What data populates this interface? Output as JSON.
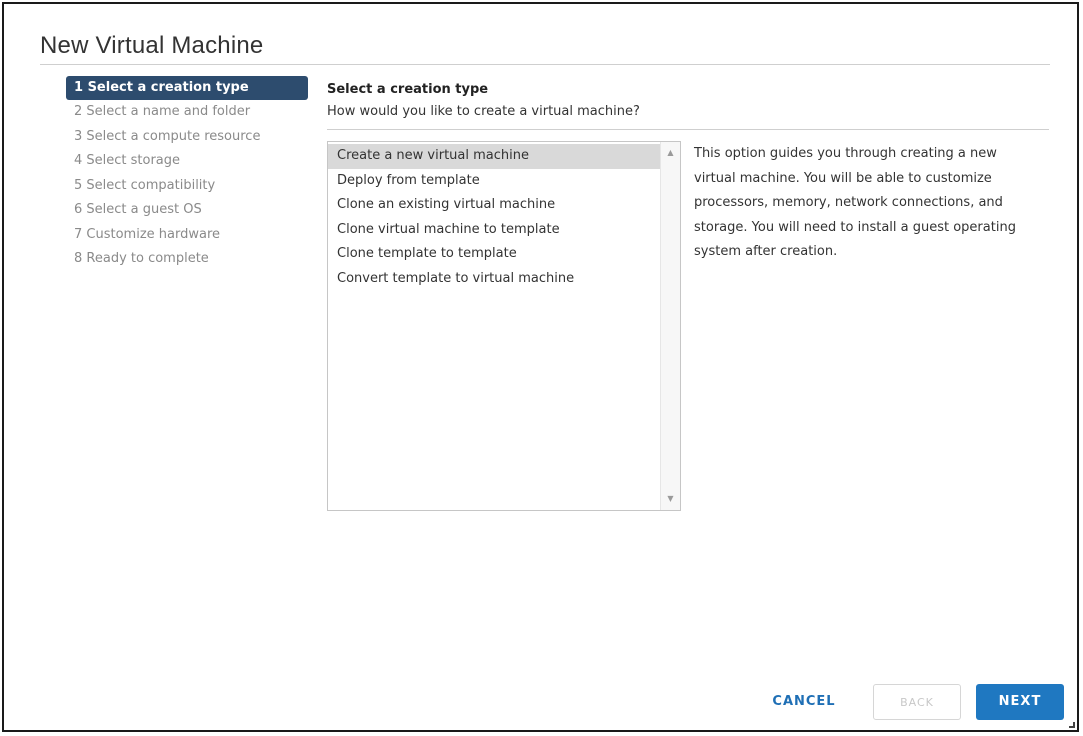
{
  "dialog": {
    "title": "New Virtual Machine"
  },
  "steps": [
    {
      "label": "1 Select a creation type",
      "active": true
    },
    {
      "label": "2 Select a name and folder",
      "active": false
    },
    {
      "label": "3 Select a compute resource",
      "active": false
    },
    {
      "label": "4 Select storage",
      "active": false
    },
    {
      "label": "5 Select compatibility",
      "active": false
    },
    {
      "label": "6 Select a guest OS",
      "active": false
    },
    {
      "label": "7 Customize hardware",
      "active": false
    },
    {
      "label": "8 Ready to complete",
      "active": false
    }
  ],
  "main": {
    "heading": "Select a creation type",
    "question": "How would you like to create a virtual machine?",
    "options": [
      {
        "label": "Create a new virtual machine",
        "selected": true
      },
      {
        "label": "Deploy from template",
        "selected": false
      },
      {
        "label": "Clone an existing virtual machine",
        "selected": false
      },
      {
        "label": "Clone virtual machine to template",
        "selected": false
      },
      {
        "label": "Clone template to template",
        "selected": false
      },
      {
        "label": "Convert template to virtual machine",
        "selected": false
      }
    ],
    "description": "This option guides you through creating a new virtual machine. You will be able to customize processors, memory, network connections, and storage. You will need to install a guest operating system after creation."
  },
  "scrollbar": {
    "up_icon": "scroll-up-arrow-icon",
    "down_icon": "scroll-down-arrow-icon"
  },
  "footer": {
    "cancel_label": "CANCEL",
    "back_label": "BACK",
    "next_label": "NEXT"
  },
  "colors": {
    "active_step_bg": "#2d4c6e",
    "primary_button": "#1f78c1",
    "link_button": "#1f6fb5",
    "selected_option_bg": "#d9d9d9"
  }
}
